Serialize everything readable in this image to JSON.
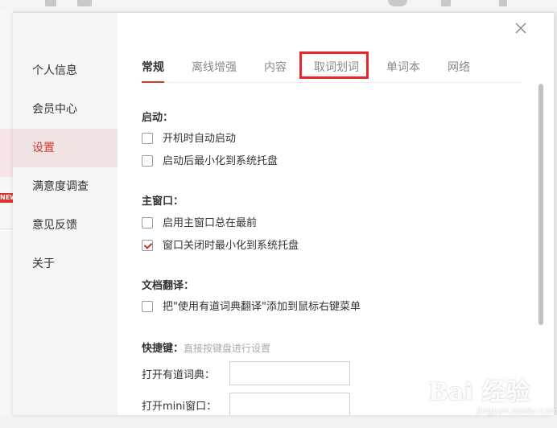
{
  "background": {
    "badge": "NEW"
  },
  "sidebar": {
    "items": [
      {
        "label": "个人信息",
        "active": false
      },
      {
        "label": "会员中心",
        "active": false
      },
      {
        "label": "设置",
        "active": true
      },
      {
        "label": "满意度调查",
        "active": false
      },
      {
        "label": "意见反馈",
        "active": false
      },
      {
        "label": "关于",
        "active": false
      }
    ]
  },
  "tabs": [
    {
      "label": "常规",
      "active": true
    },
    {
      "label": "离线增强",
      "active": false
    },
    {
      "label": "内容",
      "active": false
    },
    {
      "label": "取词划词",
      "active": false,
      "highlighted": true
    },
    {
      "label": "单词本",
      "active": false
    },
    {
      "label": "网络",
      "active": false
    }
  ],
  "sections": {
    "startup": {
      "title": "启动：",
      "options": [
        {
          "label": "开机时自动启动",
          "checked": false
        },
        {
          "label": "启动后最小化到系统托盘",
          "checked": false
        }
      ]
    },
    "main_window": {
      "title": "主窗口：",
      "options": [
        {
          "label": "启用主窗口总在最前",
          "checked": false
        },
        {
          "label": "窗口关闭时最小化到系统托盘",
          "checked": true
        }
      ]
    },
    "doc_translate": {
      "title": "文档翻译：",
      "options": [
        {
          "label": "把\"使用有道词典翻译\"添加到鼠标右键菜单",
          "checked": false
        }
      ]
    },
    "hotkeys": {
      "title": "快捷键：",
      "hint": "直接按键盘进行设置",
      "fields": [
        {
          "label": "打开有道词典：",
          "value": ""
        },
        {
          "label": "打开mini窗口：",
          "value": ""
        }
      ]
    }
  },
  "watermark": {
    "main": "Bai  经验",
    "sub": "jingyan.baidu.com"
  },
  "colors": {
    "accent": "#d13a2f",
    "highlight_box": "#e8262b",
    "sidebar_bg": "#f5f5f5",
    "sidebar_active_bg": "#efe3e3"
  },
  "icons": {
    "close": "close-icon",
    "checkbox_checked": "checkmark-icon"
  }
}
